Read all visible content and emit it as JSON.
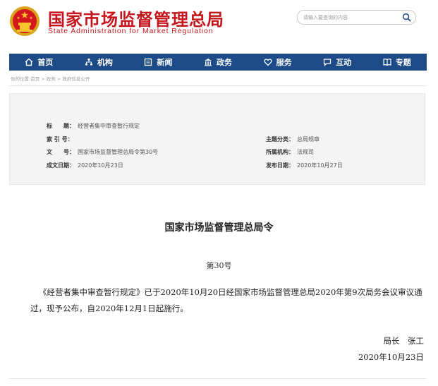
{
  "header": {
    "site_title": "国家市场监督管理总局",
    "site_subtitle": "State Administration for Market Regulation",
    "brand_color": "#c6161d",
    "search": {
      "placeholder": "请输入要查询的内容"
    }
  },
  "nav": {
    "background": "#1c4b88",
    "items": [
      {
        "label": "首页",
        "icon": "home-icon"
      },
      {
        "label": "机构",
        "icon": "org-chart-icon"
      },
      {
        "label": "新闻",
        "icon": "newspaper-icon"
      },
      {
        "label": "政务",
        "icon": "government-icon"
      },
      {
        "label": "服务",
        "icon": "heart-icon"
      },
      {
        "label": "互动",
        "icon": "chat-icon"
      },
      {
        "label": "专题",
        "icon": "book-icon"
      }
    ]
  },
  "breadcrumb": "你的位置:首页 > 政务 > 政府信息公开",
  "meta": {
    "title_label": "标　　题：",
    "title_value": "经营者集中审查暂行规定",
    "index_label": "索 引 号：",
    "index_value": "",
    "category_label": "主题分类：",
    "category_value": "总局规章",
    "docno_label": "文　　号：",
    "docno_value": "国家市场监督管理总局令第30号",
    "agency_label": "所属机构：",
    "agency_value": "法规司",
    "created_label": "成文日期：",
    "created_value": "2020年10月23日",
    "published_label": "发布日期：",
    "published_value": "2020年10月27日"
  },
  "document": {
    "heading": "国家市场监督管理总局令",
    "number": "第30号",
    "body": "《经营者集中审查暂行规定》已于2020年10月20日经国家市场监督管理总局2020年第9次局务会议审议通过，现予公布，自2020年12月1日起施行。",
    "signer": "局长　张工",
    "date": "2020年10月23日"
  }
}
